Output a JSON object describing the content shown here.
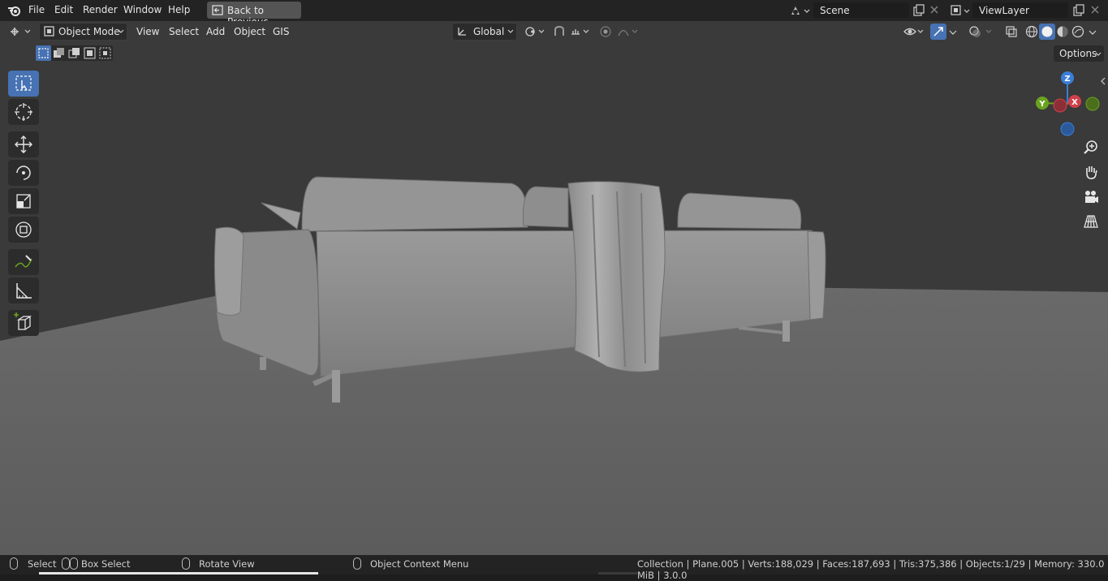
{
  "menu": [
    "File",
    "Edit",
    "Render",
    "Window",
    "Help"
  ],
  "back_button": "Back to Previous",
  "scene": {
    "name": "Scene"
  },
  "view_layer": {
    "name": "ViewLayer"
  },
  "viewport_header": {
    "mode": "Object Mode",
    "menus": [
      "View",
      "Select",
      "Add",
      "Object",
      "GIS"
    ],
    "transform_orientation": "Global",
    "options_label": "Options"
  },
  "gizmo": {
    "z": "Z",
    "y": "Y",
    "x": "X"
  },
  "status": {
    "select": "Select",
    "box_select": "Box Select",
    "rotate_view": "Rotate View",
    "context_menu": "Object Context Menu",
    "stats": "Collection | Plane.005 | Verts:188,029 | Faces:187,693 | Tris:375,386 | Objects:1/29 | Memory: 330.0 MiB | 3.0.0"
  },
  "colors": {
    "accent": "#4772b3",
    "x_axis": "#d1414b",
    "y_axis": "#6ba31f",
    "z_axis": "#3b7dd8"
  }
}
